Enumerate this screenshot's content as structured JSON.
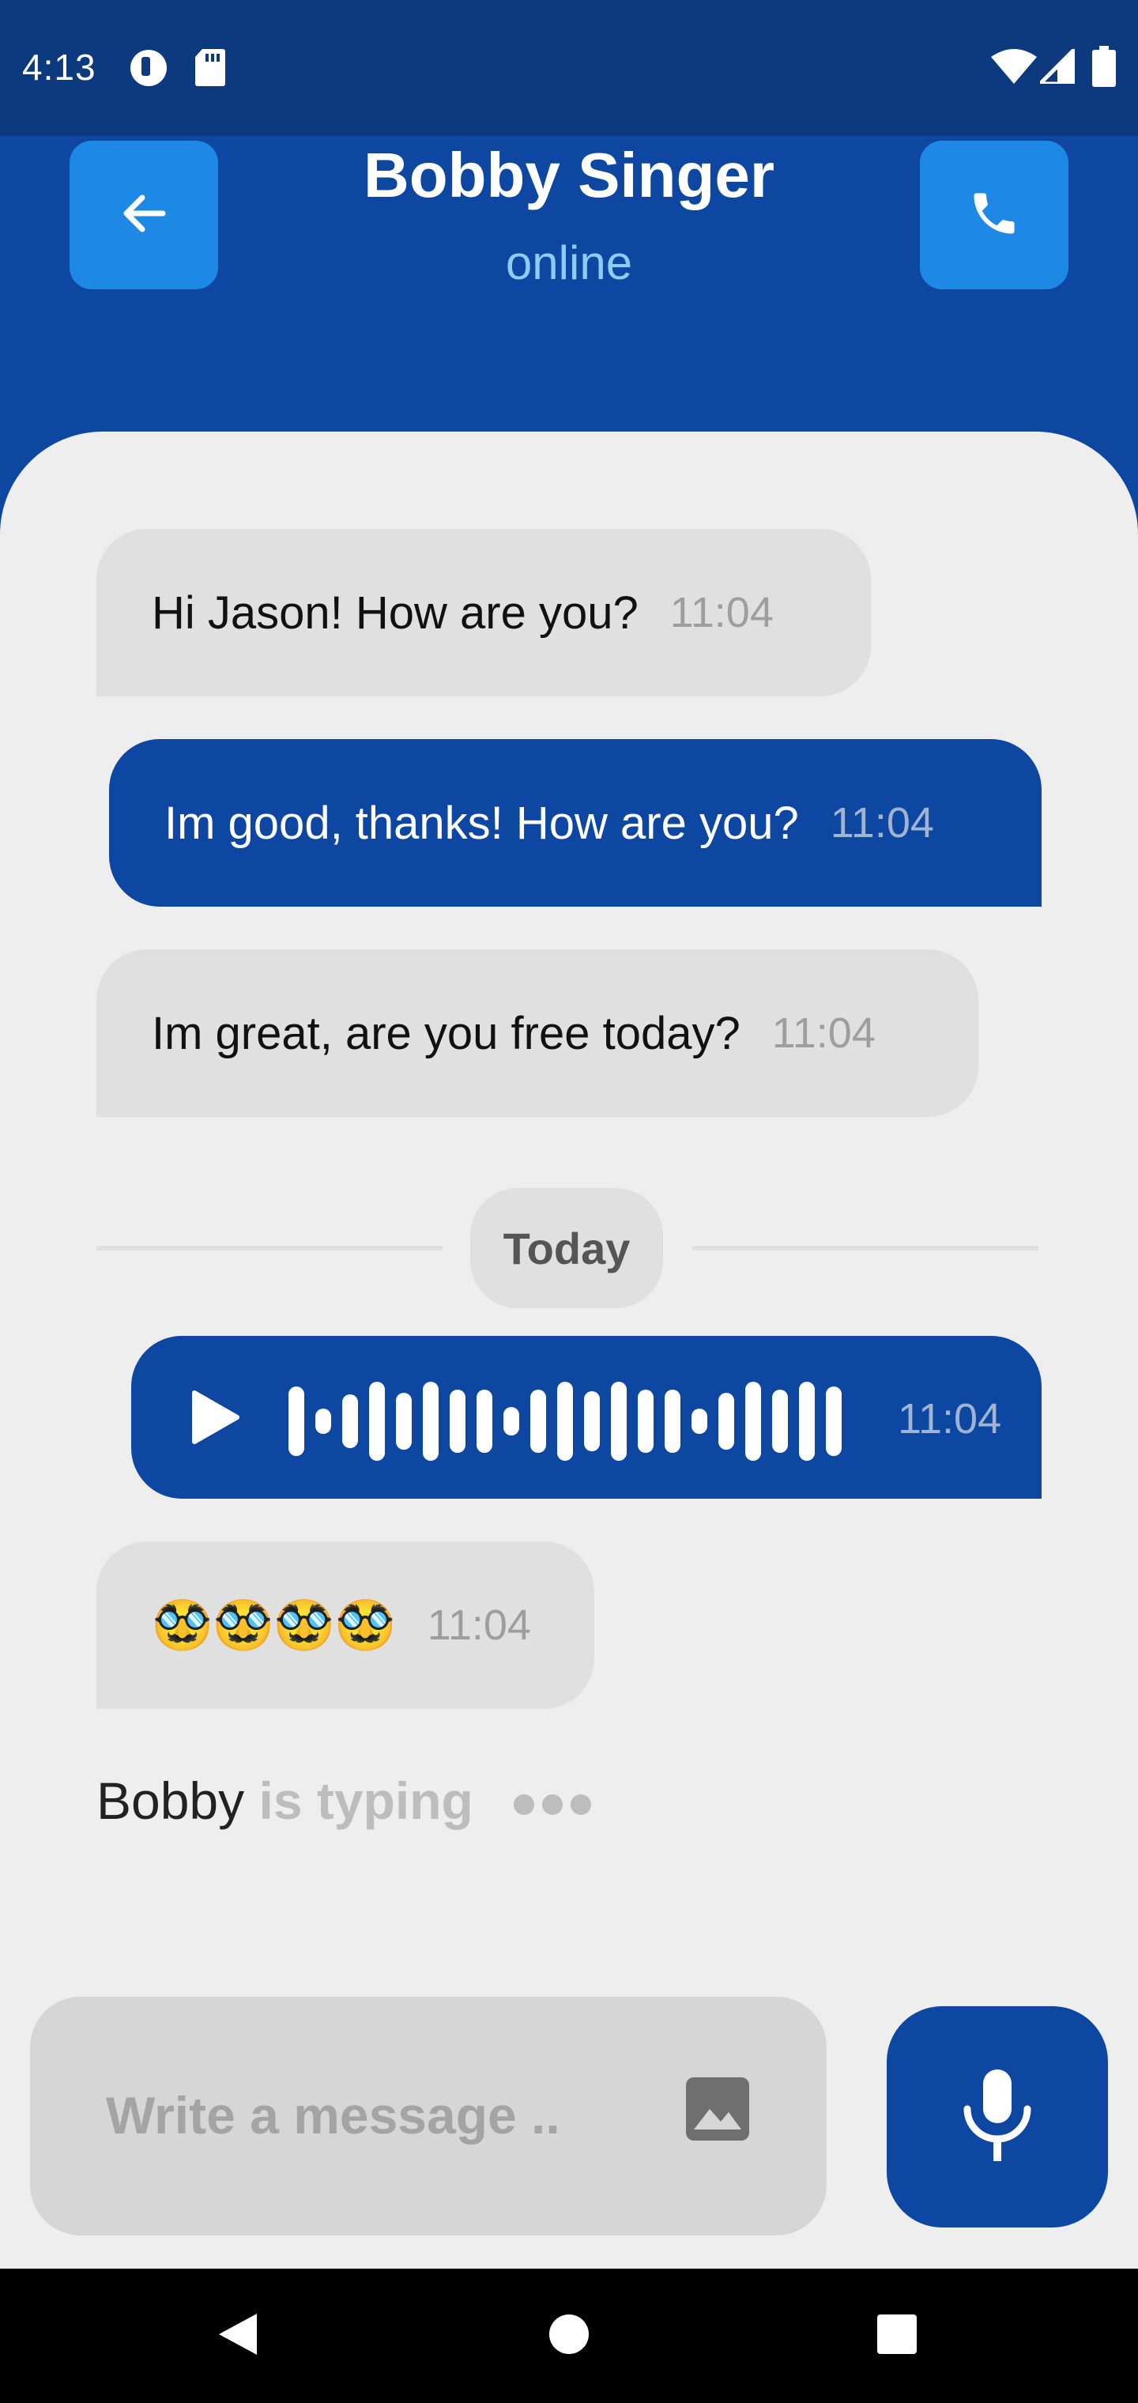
{
  "status_bar": {
    "time": "4:13",
    "left_icons": [
      "data-saver-icon",
      "sd-card-icon"
    ],
    "right_icons": [
      "wifi-icon",
      "signal-icon",
      "battery-icon"
    ]
  },
  "header": {
    "title": "Bobby Singer",
    "subtitle": "online",
    "back_icon": "arrow-left-icon",
    "call_icon": "phone-icon"
  },
  "messages": [
    {
      "direction": "incoming",
      "type": "text",
      "text": "Hi Jason! How are you?",
      "time": "11:04"
    },
    {
      "direction": "outgoing",
      "type": "text",
      "text": "Im good, thanks! How are you?",
      "time": "11:04"
    },
    {
      "direction": "incoming",
      "type": "text",
      "text": "Im great, are you free today?",
      "time": "11:04"
    },
    {
      "direction": "outgoing",
      "type": "voice",
      "play_icon": "play-icon",
      "time": "11:04"
    },
    {
      "direction": "incoming",
      "type": "emoji",
      "text": "🥸🥸🥸🥸",
      "time": "11:04"
    }
  ],
  "date_divider": "Today",
  "typing": {
    "name": "Bobby",
    "text": "is typing"
  },
  "composer": {
    "placeholder": "Write a message ..",
    "value": "",
    "image_icon": "image-icon",
    "mic_icon": "microphone-icon"
  },
  "nav_bar": {
    "icons": [
      "back-triangle-icon",
      "home-circle-icon",
      "recents-square-icon"
    ]
  },
  "colors": {
    "status_bar": "#0d3a7e",
    "primary": "#0e47a1",
    "accent_button": "#1e88e5",
    "subtitle": "#90caf9",
    "panel": "#eeeeef",
    "incoming_bubble": "#e0e0e0",
    "input_bg": "#d6d6d6"
  }
}
